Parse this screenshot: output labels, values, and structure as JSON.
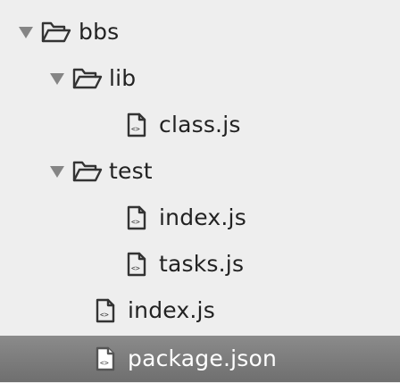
{
  "tree": {
    "items": [
      {
        "label": "bbs",
        "kind": "folder",
        "expanded": true,
        "depth": 0,
        "icon": "folder-open-icon"
      },
      {
        "label": "lib",
        "kind": "folder",
        "expanded": true,
        "depth": 1,
        "icon": "folder-open-icon"
      },
      {
        "label": "class.js",
        "kind": "file",
        "depth": 3,
        "icon": "js-file-icon"
      },
      {
        "label": "test",
        "kind": "folder",
        "expanded": true,
        "depth": 1,
        "icon": "folder-open-icon"
      },
      {
        "label": "index.js",
        "kind": "file",
        "depth": 3,
        "icon": "js-file-icon"
      },
      {
        "label": "tasks.js",
        "kind": "file",
        "depth": 3,
        "icon": "js-file-icon"
      },
      {
        "label": "index.js",
        "kind": "file",
        "depth": 2,
        "icon": "js-file-icon"
      },
      {
        "label": "package.json",
        "kind": "file",
        "depth": 2,
        "icon": "json-file-icon",
        "selected": true
      }
    ]
  },
  "colors": {
    "background": "#eeeeee",
    "selected_bg": "#7a7a7a",
    "selected_text": "#ffffff",
    "arrow": "#858585"
  }
}
